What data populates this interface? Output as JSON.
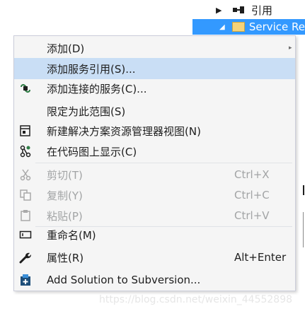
{
  "tree": {
    "references_label": "引用",
    "service_label": "Service Re"
  },
  "menu": {
    "items": [
      {
        "label": "添加(D)",
        "shortcut": "",
        "submenu": "▸"
      },
      {
        "label": "添加服务引用(S)...",
        "shortcut": ""
      },
      {
        "label": "添加连接的服务(C)...",
        "shortcut": ""
      },
      {
        "label": "限定为此范围(S)",
        "shortcut": ""
      },
      {
        "label": "新建解决方案资源管理器视图(N)",
        "shortcut": ""
      },
      {
        "label": "在代码图上显示(C)",
        "shortcut": ""
      },
      {
        "label": "剪切(T)",
        "shortcut": "Ctrl+X"
      },
      {
        "label": "复制(Y)",
        "shortcut": "Ctrl+C"
      },
      {
        "label": "粘贴(P)",
        "shortcut": "Ctrl+V"
      },
      {
        "label": "重命名(M)",
        "shortcut": ""
      },
      {
        "label": "属性(R)",
        "shortcut": "Alt+Enter"
      },
      {
        "label": "Add Solution to Subversion...",
        "shortcut": ""
      }
    ]
  },
  "watermark": "https://blog.csdn.net/weixin_44552898"
}
